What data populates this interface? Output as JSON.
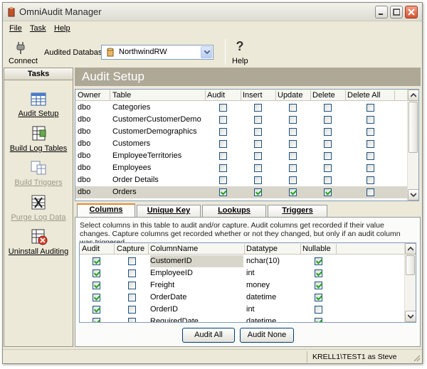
{
  "window": {
    "title": "OmniAudit Manager"
  },
  "menu": [
    "File",
    "Task",
    "Help"
  ],
  "toolbar": {
    "connect_label": "Connect",
    "db_label": "Audited Database",
    "db_value": "NorthwindRW",
    "help_label": "Help"
  },
  "tasks": {
    "header": "Tasks",
    "items": [
      {
        "label": "Audit Setup",
        "enabled": true
      },
      {
        "label": "Build Log Tables",
        "enabled": true
      },
      {
        "label": "Build Triggers",
        "enabled": false
      },
      {
        "label": "Purge Log Data",
        "enabled": false
      },
      {
        "label": "Uninstall Auditing",
        "enabled": true
      }
    ]
  },
  "audit_setup": {
    "title": "Audit Setup",
    "columns": [
      "Owner",
      "Table",
      "Audit",
      "Insert",
      "Update",
      "Delete",
      "Delete All"
    ],
    "rows": [
      {
        "owner": "dbo",
        "table": "Categories",
        "audit": false,
        "insert": false,
        "update": false,
        "delete": false,
        "delete_all": false,
        "selected": false
      },
      {
        "owner": "dbo",
        "table": "CustomerCustomerDemo",
        "audit": false,
        "insert": false,
        "update": false,
        "delete": false,
        "delete_all": false,
        "selected": false
      },
      {
        "owner": "dbo",
        "table": "CustomerDemographics",
        "audit": false,
        "insert": false,
        "update": false,
        "delete": false,
        "delete_all": false,
        "selected": false
      },
      {
        "owner": "dbo",
        "table": "Customers",
        "audit": false,
        "insert": false,
        "update": false,
        "delete": false,
        "delete_all": false,
        "selected": false
      },
      {
        "owner": "dbo",
        "table": "EmployeeTerritories",
        "audit": false,
        "insert": false,
        "update": false,
        "delete": false,
        "delete_all": false,
        "selected": false
      },
      {
        "owner": "dbo",
        "table": "Employees",
        "audit": false,
        "insert": false,
        "update": false,
        "delete": false,
        "delete_all": false,
        "selected": false
      },
      {
        "owner": "dbo",
        "table": "Order Details",
        "audit": false,
        "insert": false,
        "update": false,
        "delete": false,
        "delete_all": false,
        "selected": false
      },
      {
        "owner": "dbo",
        "table": "Orders",
        "audit": true,
        "insert": true,
        "update": true,
        "delete": true,
        "delete_all": false,
        "selected": true
      }
    ]
  },
  "tabs": [
    {
      "label": "Columns",
      "active": true
    },
    {
      "label": "Unique Key",
      "active": false
    },
    {
      "label": "Lookups",
      "active": false
    },
    {
      "label": "Triggers",
      "active": false
    }
  ],
  "columns_tab": {
    "description": "Select columns in this table to audit and/or capture. Audit columns get recorded if their value changes. Capture columns get recorded whether or not they changed, but only if an audit column was triggered.",
    "headers": [
      "Audit",
      "Capture",
      "ColumnName",
      "Datatype",
      "Nullable"
    ],
    "rows": [
      {
        "audit": true,
        "capture": false,
        "name": "CustomerID",
        "type": "nchar(10)",
        "nullable": true,
        "selected": true
      },
      {
        "audit": true,
        "capture": false,
        "name": "EmployeeID",
        "type": "int",
        "nullable": true,
        "selected": false
      },
      {
        "audit": true,
        "capture": false,
        "name": "Freight",
        "type": "money",
        "nullable": true,
        "selected": false
      },
      {
        "audit": true,
        "capture": false,
        "name": "OrderDate",
        "type": "datetime",
        "nullable": true,
        "selected": false
      },
      {
        "audit": true,
        "capture": false,
        "name": "OrderID",
        "type": "int",
        "nullable": false,
        "selected": false
      },
      {
        "audit": true,
        "capture": false,
        "name": "RequiredDate",
        "type": "datetime",
        "nullable": true,
        "selected": false
      }
    ],
    "audit_all_label": "Audit All",
    "audit_none_label": "Audit None"
  },
  "status": {
    "text": "KRELL1\\TEST1 as Steve"
  }
}
